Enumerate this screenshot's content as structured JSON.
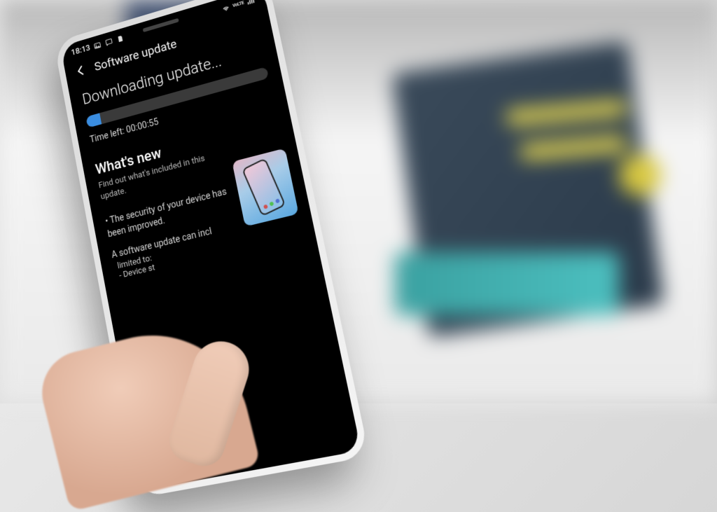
{
  "status_bar": {
    "time": "18:13",
    "icons_left": [
      "image-icon",
      "cast-icon",
      "sim-icon"
    ],
    "icons_right": [
      "wifi-icon",
      "volte-icon",
      "signal-icon"
    ]
  },
  "header": {
    "back_icon": "chevron-left",
    "title": "Software update"
  },
  "download": {
    "title": "Downloading update...",
    "progress_percent": 8,
    "time_left_label": "Time left:",
    "time_left_value": "00:00:55"
  },
  "whats_new": {
    "title": "What's new",
    "subtitle": "Find out what's included in this update.",
    "bullet1": "• The security of your device has been improved.",
    "bullet2_partial": "A software update can incl",
    "bullet2_sub1_partial": "limited to:",
    "bullet2_sub2_partial": "- Device st"
  }
}
